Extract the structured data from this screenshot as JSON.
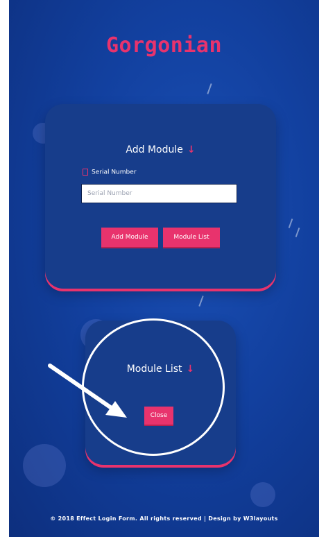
{
  "app": {
    "title": "Gorgonian"
  },
  "add_module": {
    "title": "Add Module",
    "title_icon": "arrow-down-icon",
    "field_label": "Serial Number",
    "input_placeholder": "Serial Number",
    "add_button": "Add Module",
    "list_button": "Module List"
  },
  "module_list": {
    "title": "Module List",
    "title_icon": "arrow-down-icon",
    "close_button": "Close"
  },
  "footer": {
    "text": "© 2018 Effect Login Form. All rights reserved | Design by W3layouts"
  },
  "colors": {
    "accent": "#e8336d",
    "card": "#173d8b",
    "background": "#12409f"
  }
}
